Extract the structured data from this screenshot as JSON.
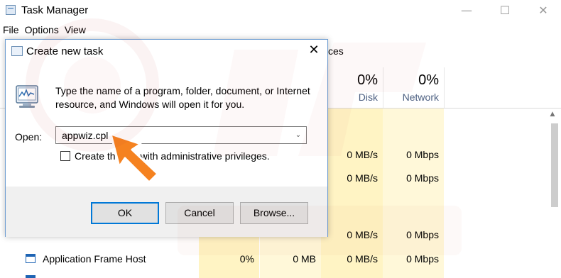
{
  "taskmanager": {
    "title": "Task Manager",
    "menu": [
      "File",
      "Options",
      "View"
    ],
    "tab_fragment": "ces",
    "columns": [
      {
        "percent": "0%",
        "label": "Disk"
      },
      {
        "percent": "0%",
        "label": "Network"
      }
    ],
    "rows": [
      {
        "disk": "0 MB/s",
        "network": "0 Mbps"
      },
      {
        "disk": "0 MB/s",
        "network": "0 Mbps"
      },
      {
        "disk": "0 MB/s",
        "network": "0 Mbps"
      },
      {
        "name": "Application Frame Host",
        "cpu": "0%",
        "memory": "0 MB",
        "disk": "0 MB/s",
        "network": "0 Mbps"
      }
    ],
    "window_controls": {
      "minimize": "—",
      "maximize": "☐",
      "close": "✕"
    }
  },
  "dialog": {
    "title": "Create new task",
    "close_glyph": "✕",
    "description": "Type the name of a program, folder, document, or Internet resource, and Windows will open it for you.",
    "open_label": "Open:",
    "open_value": "appwiz.cpl",
    "dropdown_glyph": "⌄",
    "admin_checkbox_label": "Create th         with administrative privileges.",
    "admin_checked": false,
    "buttons": {
      "ok": "OK",
      "cancel": "Cancel",
      "browse": "Browse..."
    }
  },
  "icons": {
    "app": "task-manager-icon",
    "run": "run-program-icon",
    "pointer": "orange-arrow-annotation"
  },
  "colors": {
    "accent": "#0078d7",
    "arrow": "#f58220",
    "highlight_column": "#fff4c4"
  }
}
